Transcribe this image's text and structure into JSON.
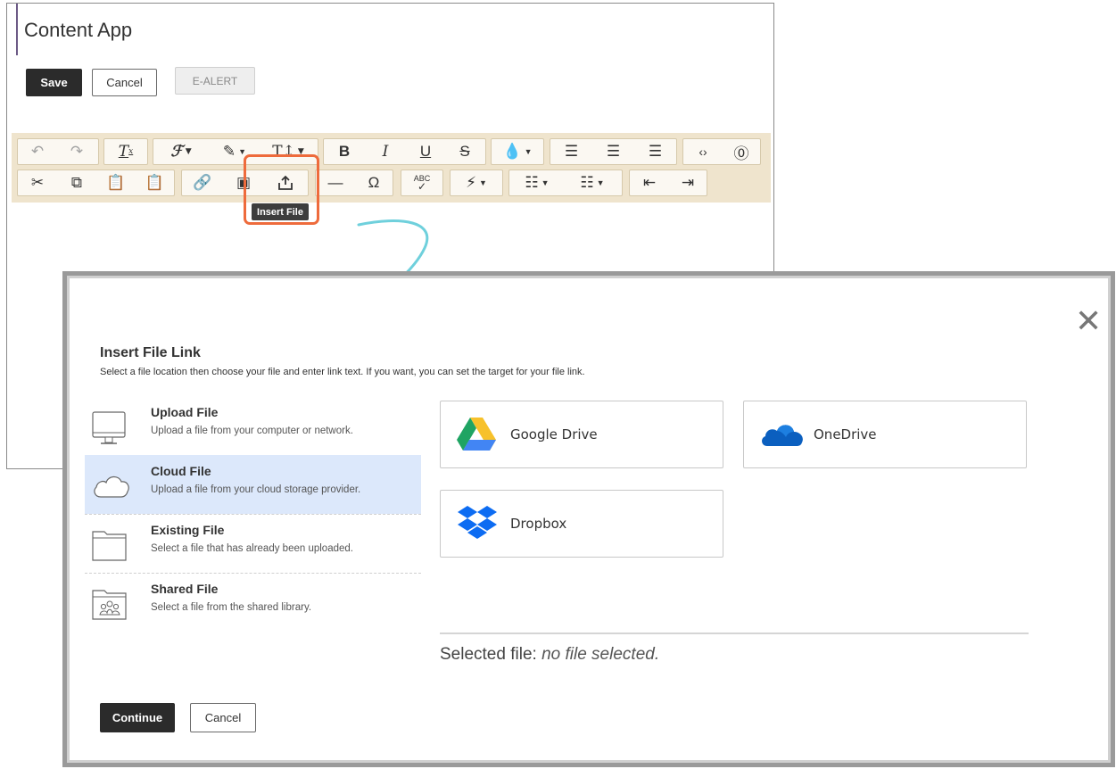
{
  "editor": {
    "app_title": "Content App",
    "save_label": "Save",
    "cancel_label": "Cancel",
    "ealert_label": "E-ALERT",
    "tooltip": "Insert File",
    "toolbar_row1": [
      "undo-icon",
      "redo-icon",
      "clear-format-icon",
      "font-family-icon",
      "brush-icon",
      "font-size-icon",
      "bold-icon",
      "italic-icon",
      "underline-icon",
      "strikethrough-icon",
      "color-icon",
      "align-left-icon",
      "align-center-icon",
      "align-right-icon",
      "code-icon",
      "help-icon"
    ],
    "toolbar_row2": [
      "cut-icon",
      "copy-icon",
      "paste-icon",
      "paste-text-icon",
      "link-icon",
      "image-icon",
      "insert-file-icon",
      "horizontal-rule-icon",
      "omega-icon",
      "spellcheck-icon",
      "bolt-icon",
      "bullet-list-icon",
      "numbered-list-icon",
      "outdent-icon",
      "indent-icon"
    ]
  },
  "dialog": {
    "title": "Insert File Link",
    "description": "Select a file location then choose your file and enter link text. If you want, you can set the target for your file link.",
    "close_icon": "close-icon",
    "locations": [
      {
        "title": "Upload File",
        "subtitle": "Upload a file from your computer or network.",
        "icon": "monitor-icon",
        "selected": false
      },
      {
        "title": "Cloud File",
        "subtitle": "Upload a file from your cloud storage provider.",
        "icon": "cloud-icon",
        "selected": true
      },
      {
        "title": "Existing File",
        "subtitle": "Select a file that has already been uploaded.",
        "icon": "folder-icon",
        "selected": false
      },
      {
        "title": "Shared File",
        "subtitle": "Select a file from the shared library.",
        "icon": "shared-folder-icon",
        "selected": false
      }
    ],
    "providers": [
      {
        "label": "Google Drive",
        "icon": "google-drive-icon"
      },
      {
        "label": "OneDrive",
        "icon": "onedrive-icon"
      },
      {
        "label": "Dropbox",
        "icon": "dropbox-icon"
      }
    ],
    "selected_file_label": "Selected file:",
    "selected_file_value": "no file selected.",
    "continue_label": "Continue",
    "cancel_label": "Cancel"
  },
  "colors": {
    "toolbar_bg": "#efe4cd",
    "highlight": "#ee6b3c",
    "selected_row": "#dce8fb",
    "arrow": "#6fd0dc",
    "primary_button": "#2b2b2b"
  }
}
